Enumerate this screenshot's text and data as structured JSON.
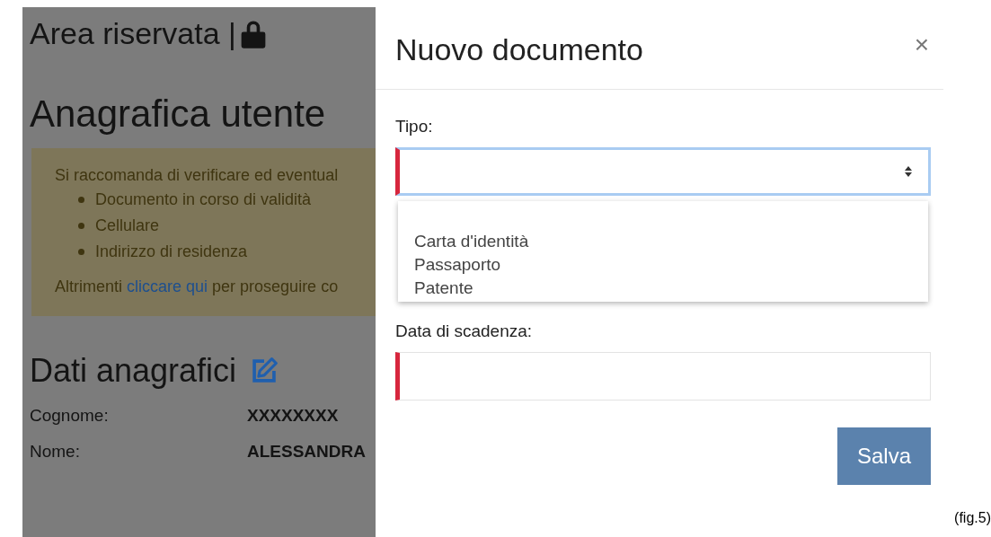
{
  "background": {
    "title": "Area riservata |",
    "heading": "Anagrafica utente",
    "alert": {
      "intro": "Si raccomanda di verificare ed eventual",
      "items": [
        "Documento in corso di validità",
        "Cellulare",
        "Indirizzo di residenza"
      ],
      "outro_before": "Altrimenti",
      "link": "cliccare qui",
      "outro_after": "per proseguire co"
    },
    "section_title": "Dati anagrafici",
    "fields": [
      {
        "label": "Cognome:",
        "value": "XXXXXXXX"
      },
      {
        "label": "Nome:",
        "value": "ALESSANDRA"
      }
    ]
  },
  "modal": {
    "title": "Nuovo documento",
    "close": "×",
    "fields": [
      {
        "label": "Tipo:",
        "kind": "select",
        "invalid": true,
        "focused": true
      },
      {
        "label": "Data di scadenza:",
        "kind": "input",
        "invalid": true,
        "focused": false
      }
    ],
    "dropdown": {
      "open": true,
      "options": [
        "Carta d'identità",
        "Passaporto",
        "Patente"
      ]
    },
    "save_button": "Salva"
  },
  "caption": "(fig.5)"
}
